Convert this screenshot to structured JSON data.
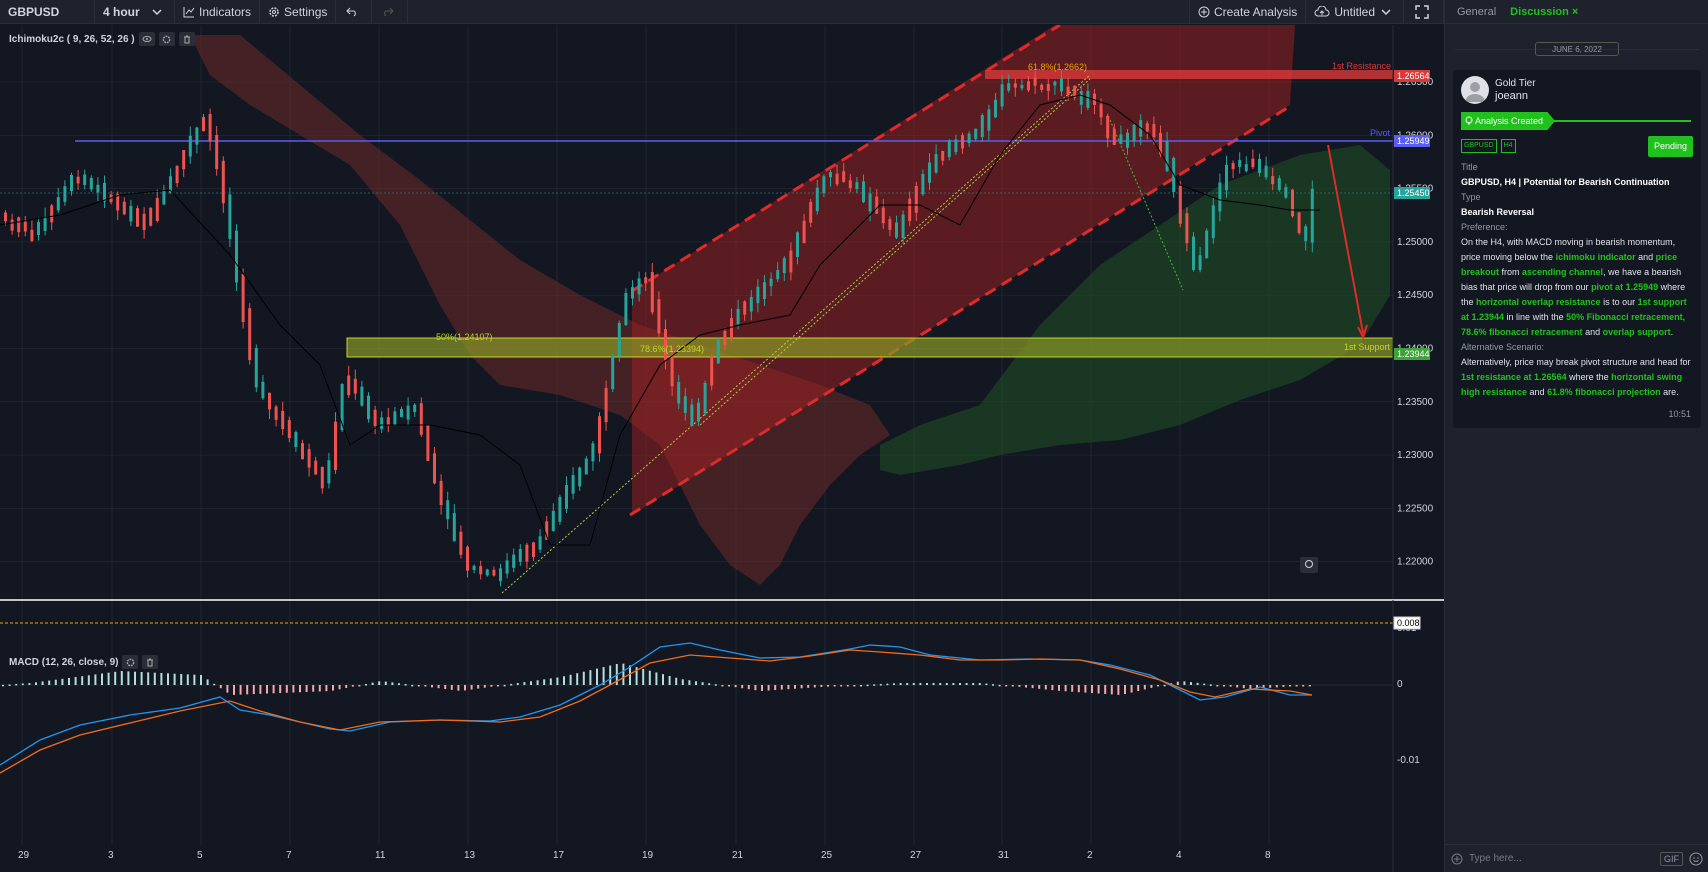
{
  "toolbar": {
    "symbol": "GBPUSD",
    "interval": "4 hour",
    "indicators_label": "Indicators",
    "settings_label": "Settings",
    "create_label": "Create Analysis",
    "untitled_label": "Untitled"
  },
  "legends": {
    "ichimoku": "Ichimoku2c ( 9, 26, 52, 26 )",
    "macd": "MACD (12, 26, close, 9)"
  },
  "price_axis": {
    "ticks": [
      "1.26500",
      "1.26000",
      "1.25500",
      "1.25000",
      "1.24500",
      "1.24000",
      "1.23500",
      "1.23000",
      "1.22500",
      "1.22000"
    ],
    "tags": [
      "1.26564",
      "1.25949",
      "1.25450",
      "1.23944"
    ]
  },
  "macd_axis": {
    "ticks": [
      "0.01",
      "0",
      "-0.01"
    ],
    "tag": "0.008"
  },
  "time_axis": [
    "29",
    "3",
    "5",
    "7",
    "11",
    "13",
    "17",
    "19",
    "21",
    "25",
    "27",
    "31",
    "2",
    "4",
    "8"
  ],
  "annotations": {
    "fib_618": "61.8%(1.2662)",
    "fib_50": "50%(1.24107)",
    "fib_786": "78.6%(1.23394)",
    "resistance": "1st Resistance",
    "pivot": "Pivot",
    "support": "1st Support"
  },
  "colors": {
    "bull": "#26a69a",
    "bear": "#ef5350",
    "accent": "#21c11d",
    "pivot": "#5a5ff0",
    "channel": "#e12a2a"
  },
  "sidebar": {
    "tabs": [
      "General",
      "Discussion"
    ],
    "date": "JUNE 6, 2022",
    "tier": "Gold Tier",
    "username": "joeann",
    "created": "Analysis Created",
    "tags": [
      "GBPUSD",
      "H4"
    ],
    "status": "Pending",
    "title_label": "Title",
    "title": "GBPUSD, H4 | Potential for Bearish Continuation",
    "type_label": "Type",
    "type": "Bearish Reversal",
    "pref_label": "Preference:",
    "pref_body": {
      "t1": "On the H4, with MACD moving in bearish momentum, price moving below the ",
      "h1": "ichimoku indicator",
      "t2": " and ",
      "h2": "price breakout",
      "t3": " from ",
      "h3": "ascending channel",
      "t4": ", we have a bearish bias that price will drop from our ",
      "h4": "pivot at 1.25949",
      "t5": " where the ",
      "h5": "horizontal overlap resistance",
      "t6": " is to our ",
      "h6": "1st support at 1.23944",
      "t7": " in line with the ",
      "h7": "50% Fibonacci retracement, 78.6% fibonacci retracement",
      "t8": " and ",
      "h8": "overlap support",
      "t9": "."
    },
    "alt_label": "Alternative Scenario:",
    "alt_body": {
      "t1": "Alternatively, price may break pivot structure and head for ",
      "h1": "1st resistance at 1.26564",
      "t2": " where the ",
      "h2": "horizontal swing high resistance",
      "t3": " and ",
      "h3": "61.8% fibonacci projection",
      "t4": " are."
    },
    "time": "10:51",
    "compose_placeholder": "Type here...",
    "gif": "GIF"
  }
}
